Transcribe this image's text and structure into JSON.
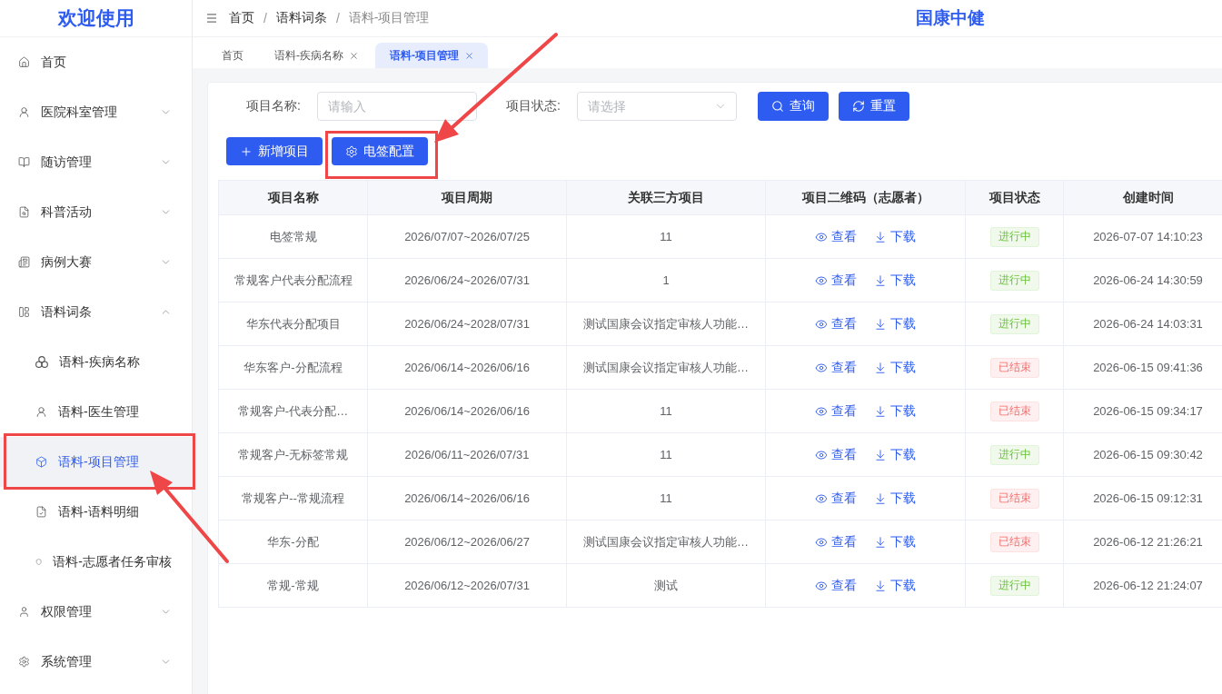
{
  "sidebar": {
    "title": "欢迎使用",
    "items": [
      {
        "label": "首页",
        "kind": "link"
      },
      {
        "label": "医院科室管理",
        "kind": "group",
        "expanded": false
      },
      {
        "label": "随访管理",
        "kind": "group",
        "expanded": false
      },
      {
        "label": "科普活动",
        "kind": "group",
        "expanded": false
      },
      {
        "label": "病例大赛",
        "kind": "group",
        "expanded": false
      },
      {
        "label": "语料词条",
        "kind": "group",
        "expanded": true,
        "children": [
          {
            "label": "语料-疾病名称",
            "selected": false,
            "highlighted": false
          },
          {
            "label": "语料-医生管理",
            "selected": false,
            "highlighted": false
          },
          {
            "label": "语料-项目管理",
            "selected": true,
            "highlighted": true
          },
          {
            "label": "语料-语料明细",
            "selected": false,
            "highlighted": false
          },
          {
            "label": "语料-志愿者任务审核",
            "selected": false,
            "highlighted": false
          }
        ]
      },
      {
        "label": "权限管理",
        "kind": "group",
        "expanded": false
      },
      {
        "label": "系统管理",
        "kind": "group",
        "expanded": false
      }
    ]
  },
  "header": {
    "breadcrumb": [
      {
        "kind": "crumb",
        "text": "首页"
      },
      {
        "kind": "separator",
        "text": "/"
      },
      {
        "kind": "crumb",
        "text": "语料词条"
      },
      {
        "kind": "separator",
        "text": "/"
      },
      {
        "kind": "current",
        "text": "语料-项目管理"
      }
    ],
    "brand": "国康中健"
  },
  "tabs": [
    {
      "label": "首页",
      "selected": false,
      "closable": false
    },
    {
      "label": "语料-疾病名称",
      "selected": false,
      "closable": true
    },
    {
      "label": "语料-项目管理",
      "selected": true,
      "closable": true
    }
  ],
  "filters": [
    {
      "label": "项目名称:",
      "kind": "input",
      "placeholder": "请输入"
    },
    {
      "label": "项目状态:",
      "kind": "select",
      "placeholder": "请选择"
    }
  ],
  "filter_buttons": [
    {
      "label": "查询",
      "kind": "search"
    },
    {
      "label": "重置",
      "kind": "reset"
    }
  ],
  "toolbar": [
    {
      "label": "新增项目",
      "kind": "add",
      "highlighted": false
    },
    {
      "label": "电签配置",
      "kind": "settings",
      "highlighted": true
    }
  ],
  "table": {
    "columns": [
      "项目名称",
      "项目周期",
      "关联三方项目",
      "项目二维码（志愿者）",
      "项目状态",
      "创建时间"
    ],
    "rows": [
      {
        "name": "电签常规",
        "period": "2026/07/07~2026/07/25",
        "third_party": "11",
        "actions": [
          {
            "label": "查看",
            "kind": "view"
          },
          {
            "label": "下载",
            "kind": "download"
          }
        ],
        "status": {
          "label": "进行中",
          "kind": "active"
        },
        "created": "2026-07-07 14:10:23"
      },
      {
        "name": "常规客户代表分配流程",
        "period": "2026/06/24~2026/07/31",
        "third_party": "1",
        "actions": [
          {
            "label": "查看",
            "kind": "view"
          },
          {
            "label": "下载",
            "kind": "download"
          }
        ],
        "status": {
          "label": "进行中",
          "kind": "active"
        },
        "created": "2026-06-24 14:30:59"
      },
      {
        "name": "华东代表分配项目",
        "period": "2026/06/24~2028/07/31",
        "third_party": "测试国康会议指定审核人功能…",
        "actions": [
          {
            "label": "查看",
            "kind": "view"
          },
          {
            "label": "下载",
            "kind": "download"
          }
        ],
        "status": {
          "label": "进行中",
          "kind": "active"
        },
        "created": "2026-06-24 14:03:31"
      },
      {
        "name": "华东客户-分配流程",
        "period": "2026/06/14~2026/06/16",
        "third_party": "测试国康会议指定审核人功能…",
        "actions": [
          {
            "label": "查看",
            "kind": "view"
          },
          {
            "label": "下载",
            "kind": "download"
          }
        ],
        "status": {
          "label": "已结束",
          "kind": "ended"
        },
        "created": "2026-06-15 09:41:36"
      },
      {
        "name": "常规客户-代表分配…",
        "period": "2026/06/14~2026/06/16",
        "third_party": "11",
        "actions": [
          {
            "label": "查看",
            "kind": "view"
          },
          {
            "label": "下载",
            "kind": "download"
          }
        ],
        "status": {
          "label": "已结束",
          "kind": "ended"
        },
        "created": "2026-06-15 09:34:17"
      },
      {
        "name": "常规客户-无标签常规",
        "period": "2026/06/11~2026/07/31",
        "third_party": "11",
        "actions": [
          {
            "label": "查看",
            "kind": "view"
          },
          {
            "label": "下载",
            "kind": "download"
          }
        ],
        "status": {
          "label": "进行中",
          "kind": "active"
        },
        "created": "2026-06-15 09:30:42"
      },
      {
        "name": "常规客户--常规流程",
        "period": "2026/06/14~2026/06/16",
        "third_party": "11",
        "actions": [
          {
            "label": "查看",
            "kind": "view"
          },
          {
            "label": "下载",
            "kind": "download"
          }
        ],
        "status": {
          "label": "已结束",
          "kind": "ended"
        },
        "created": "2026-06-15 09:12:31"
      },
      {
        "name": "华东-分配",
        "period": "2026/06/12~2026/06/27",
        "third_party": "测试国康会议指定审核人功能…",
        "actions": [
          {
            "label": "查看",
            "kind": "view"
          },
          {
            "label": "下载",
            "kind": "download"
          }
        ],
        "status": {
          "label": "已结束",
          "kind": "ended"
        },
        "created": "2026-06-12 21:26:21"
      },
      {
        "name": "常规-常规",
        "period": "2026/06/12~2026/07/31",
        "third_party": "测试",
        "actions": [
          {
            "label": "查看",
            "kind": "view"
          },
          {
            "label": "下载",
            "kind": "download"
          }
        ],
        "status": {
          "label": "进行中",
          "kind": "active"
        },
        "created": "2026-06-12 21:24:07"
      }
    ]
  }
}
